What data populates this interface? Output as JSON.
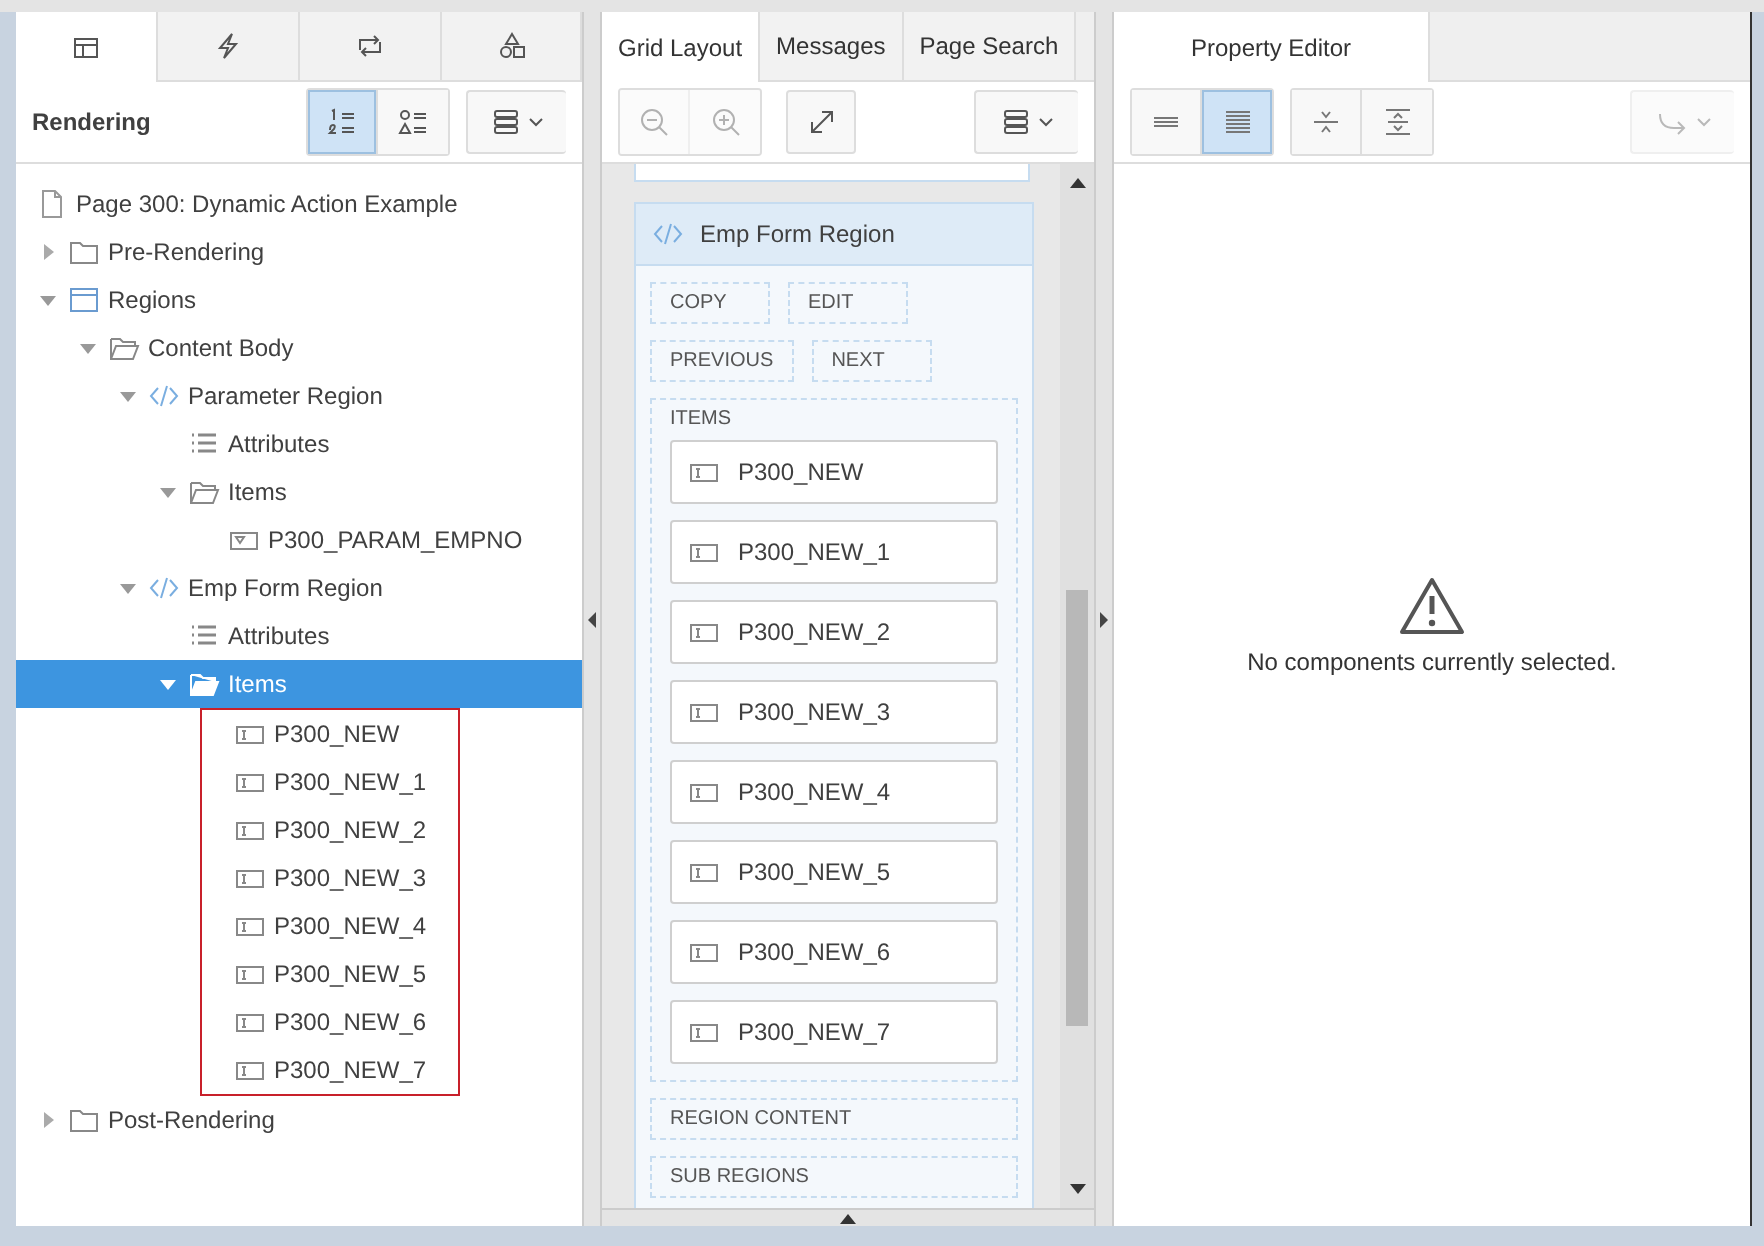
{
  "left_panel": {
    "tabs": [
      {
        "kind": "rendering",
        "selected": true
      },
      {
        "kind": "dynamic-actions",
        "selected": false
      },
      {
        "kind": "processing",
        "selected": false
      },
      {
        "kind": "shared-components",
        "selected": false
      }
    ],
    "title": "Rendering",
    "view_buttons": [
      {
        "kind": "numbered",
        "selected": true
      },
      {
        "kind": "grouped",
        "selected": false
      }
    ],
    "page_title": "Page 300: Dynamic Action Example",
    "tree": [
      {
        "label": "Pre-Rendering",
        "kind": "folder",
        "expanded": false,
        "selected": false
      },
      {
        "label": "Regions",
        "kind": "regions",
        "expanded": true,
        "selected": false,
        "children": [
          {
            "label": "Content Body",
            "kind": "folder-open",
            "expanded": true,
            "selected": false,
            "children": [
              {
                "label": "Parameter Region",
                "kind": "region",
                "expanded": true,
                "selected": false,
                "children": [
                  {
                    "label": "Attributes",
                    "kind": "attributes",
                    "selected": false
                  },
                  {
                    "label": "Items",
                    "kind": "folder-open",
                    "expanded": true,
                    "selected": false,
                    "children": [
                      {
                        "label": "P300_PARAM_EMPNO",
                        "kind": "select-item",
                        "selected": false
                      }
                    ]
                  }
                ]
              },
              {
                "label": "Emp Form Region",
                "kind": "region",
                "expanded": true,
                "selected": false,
                "children": [
                  {
                    "label": "Attributes",
                    "kind": "attributes",
                    "selected": false
                  },
                  {
                    "label": "Items",
                    "kind": "folder-open",
                    "expanded": true,
                    "selected": true,
                    "outlined": true,
                    "children": [
                      {
                        "label": "P300_NEW",
                        "kind": "text-item",
                        "selected": false
                      },
                      {
                        "label": "P300_NEW_1",
                        "kind": "text-item",
                        "selected": false
                      },
                      {
                        "label": "P300_NEW_2",
                        "kind": "text-item",
                        "selected": false
                      },
                      {
                        "label": "P300_NEW_3",
                        "kind": "text-item",
                        "selected": false
                      },
                      {
                        "label": "P300_NEW_4",
                        "kind": "text-item",
                        "selected": false
                      },
                      {
                        "label": "P300_NEW_5",
                        "kind": "text-item",
                        "selected": false
                      },
                      {
                        "label": "P300_NEW_6",
                        "kind": "text-item",
                        "selected": false
                      },
                      {
                        "label": "P300_NEW_7",
                        "kind": "text-item",
                        "selected": false
                      }
                    ]
                  }
                ]
              }
            ]
          }
        ]
      },
      {
        "label": "Post-Rendering",
        "kind": "folder",
        "expanded": false,
        "selected": false
      }
    ]
  },
  "middle_panel": {
    "tabs": [
      {
        "label": "Grid Layout",
        "selected": true
      },
      {
        "label": "Messages",
        "selected": false
      },
      {
        "label": "Page Search",
        "selected": false
      }
    ],
    "zoom_disabled": true,
    "region": {
      "title": "Emp Form Region",
      "button_rows": [
        [
          "COPY",
          "EDIT"
        ],
        [
          "PREVIOUS",
          "NEXT"
        ]
      ],
      "items_label": "ITEMS",
      "items": [
        "P300_NEW",
        "P300_NEW_1",
        "P300_NEW_2",
        "P300_NEW_3",
        "P300_NEW_4",
        "P300_NEW_5",
        "P300_NEW_6",
        "P300_NEW_7"
      ],
      "sections": [
        "REGION CONTENT",
        "SUB REGIONS"
      ]
    }
  },
  "right_panel": {
    "tabs": [
      {
        "label": "Property Editor",
        "selected": true
      }
    ],
    "display_buttons": [
      {
        "selected": false
      },
      {
        "selected": true
      }
    ],
    "goto_disabled": true,
    "message": "No components currently selected."
  }
}
